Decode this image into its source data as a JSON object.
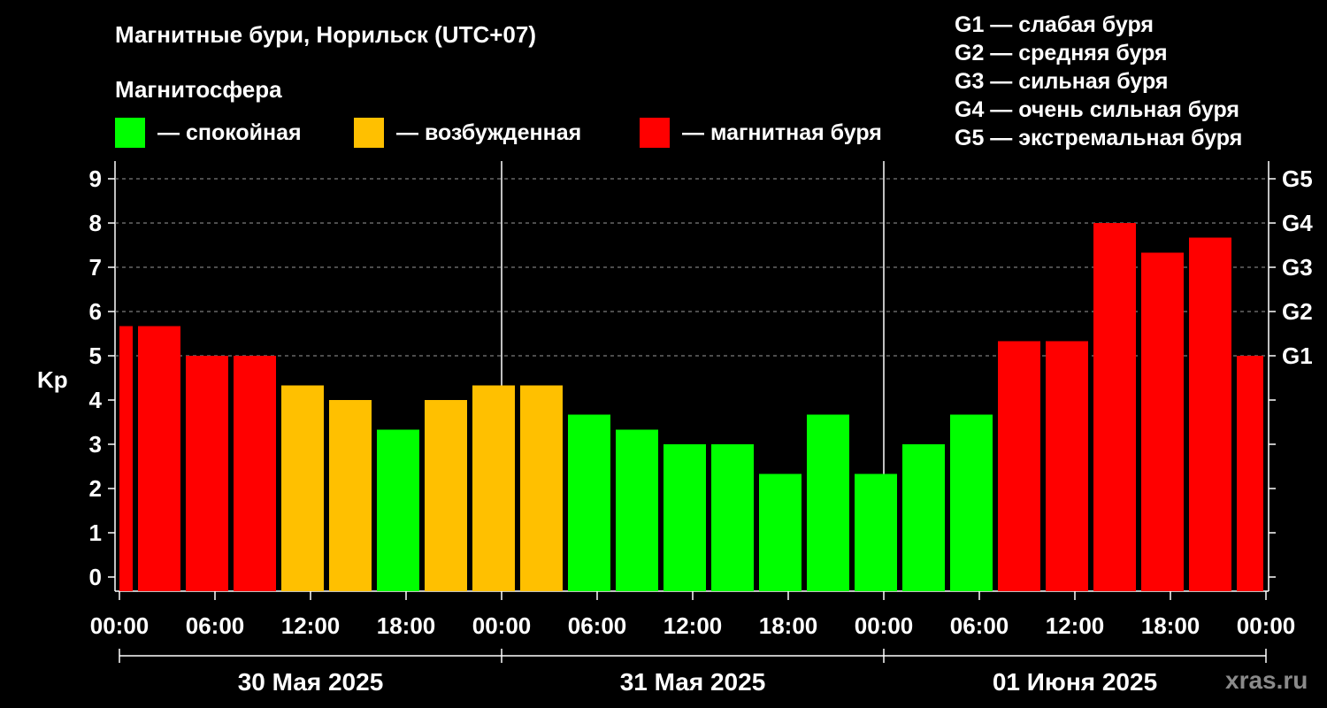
{
  "title": "Магнитные бури, Норильск (UTC+07)",
  "subtitle": "Магнитосфера",
  "legend": [
    {
      "label": "— спокойная",
      "color": "#00ff00"
    },
    {
      "label": "— возбужденная",
      "color": "#ffc000"
    },
    {
      "label": "— магнитная буря",
      "color": "#ff0000"
    }
  ],
  "g_scale": [
    "G1 — слабая буря",
    "G2 — средняя буря",
    "G3 — сильная буря",
    "G4 — очень сильная буря",
    "G5 — экстремальная буря"
  ],
  "watermark": "xras.ru",
  "chart_data": {
    "type": "bar",
    "ylabel": "Kp",
    "ylim": [
      0,
      9
    ],
    "yticks": [
      0,
      1,
      2,
      3,
      4,
      5,
      6,
      7,
      8,
      9
    ],
    "right_ticks": [
      {
        "value": 5,
        "label": "G1"
      },
      {
        "value": 6,
        "label": "G2"
      },
      {
        "value": 7,
        "label": "G3"
      },
      {
        "value": 8,
        "label": "G4"
      },
      {
        "value": 9,
        "label": "G5"
      }
    ],
    "xtick_labels": [
      "00:00",
      "06:00",
      "12:00",
      "18:00",
      "00:00",
      "06:00",
      "12:00",
      "18:00",
      "00:00",
      "06:00",
      "12:00",
      "18:00",
      "00:00"
    ],
    "days": [
      "30 Мая 2025",
      "31 Мая 2025",
      "01 Июня 2025"
    ],
    "grid": "dashed horizontal at Kp 5-9",
    "bars": [
      {
        "start": "2025-05-30 00:00",
        "end": "2025-05-30 01:00",
        "kp": 5.67,
        "level": "storm"
      },
      {
        "start": "2025-05-30 01:00",
        "end": "2025-05-30 04:00",
        "kp": 5.67,
        "level": "storm"
      },
      {
        "start": "2025-05-30 04:00",
        "end": "2025-05-30 07:00",
        "kp": 5.0,
        "level": "storm"
      },
      {
        "start": "2025-05-30 07:00",
        "end": "2025-05-30 10:00",
        "kp": 5.0,
        "level": "storm"
      },
      {
        "start": "2025-05-30 10:00",
        "end": "2025-05-30 13:00",
        "kp": 4.33,
        "level": "excited"
      },
      {
        "start": "2025-05-30 13:00",
        "end": "2025-05-30 16:00",
        "kp": 4.0,
        "level": "excited"
      },
      {
        "start": "2025-05-30 16:00",
        "end": "2025-05-30 19:00",
        "kp": 3.33,
        "level": "quiet"
      },
      {
        "start": "2025-05-30 19:00",
        "end": "2025-05-30 22:00",
        "kp": 4.0,
        "level": "excited"
      },
      {
        "start": "2025-05-30 22:00",
        "end": "2025-05-31 01:00",
        "kp": 4.33,
        "level": "excited"
      },
      {
        "start": "2025-05-31 01:00",
        "end": "2025-05-31 04:00",
        "kp": 4.33,
        "level": "excited"
      },
      {
        "start": "2025-05-31 04:00",
        "end": "2025-05-31 07:00",
        "kp": 3.67,
        "level": "quiet"
      },
      {
        "start": "2025-05-31 07:00",
        "end": "2025-05-31 10:00",
        "kp": 3.33,
        "level": "quiet"
      },
      {
        "start": "2025-05-31 10:00",
        "end": "2025-05-31 13:00",
        "kp": 3.0,
        "level": "quiet"
      },
      {
        "start": "2025-05-31 13:00",
        "end": "2025-05-31 16:00",
        "kp": 3.0,
        "level": "quiet"
      },
      {
        "start": "2025-05-31 16:00",
        "end": "2025-05-31 19:00",
        "kp": 2.33,
        "level": "quiet"
      },
      {
        "start": "2025-05-31 19:00",
        "end": "2025-05-31 22:00",
        "kp": 3.67,
        "level": "quiet"
      },
      {
        "start": "2025-05-31 22:00",
        "end": "2025-06-01 01:00",
        "kp": 2.33,
        "level": "quiet"
      },
      {
        "start": "2025-06-01 01:00",
        "end": "2025-06-01 04:00",
        "kp": 3.0,
        "level": "quiet"
      },
      {
        "start": "2025-06-01 04:00",
        "end": "2025-06-01 07:00",
        "kp": 3.67,
        "level": "quiet"
      },
      {
        "start": "2025-06-01 07:00",
        "end": "2025-06-01 10:00",
        "kp": 5.33,
        "level": "storm"
      },
      {
        "start": "2025-06-01 10:00",
        "end": "2025-06-01 13:00",
        "kp": 5.33,
        "level": "storm"
      },
      {
        "start": "2025-06-01 13:00",
        "end": "2025-06-01 16:00",
        "kp": 8.0,
        "level": "storm"
      },
      {
        "start": "2025-06-01 16:00",
        "end": "2025-06-01 19:00",
        "kp": 7.33,
        "level": "storm"
      },
      {
        "start": "2025-06-01 19:00",
        "end": "2025-06-01 22:00",
        "kp": 7.67,
        "level": "storm"
      },
      {
        "start": "2025-06-01 22:00",
        "end": "2025-06-02 00:00",
        "kp": 5.0,
        "level": "storm"
      }
    ],
    "level_colors": {
      "quiet": "#00ff00",
      "excited": "#ffc000",
      "storm": "#ff0000"
    }
  }
}
